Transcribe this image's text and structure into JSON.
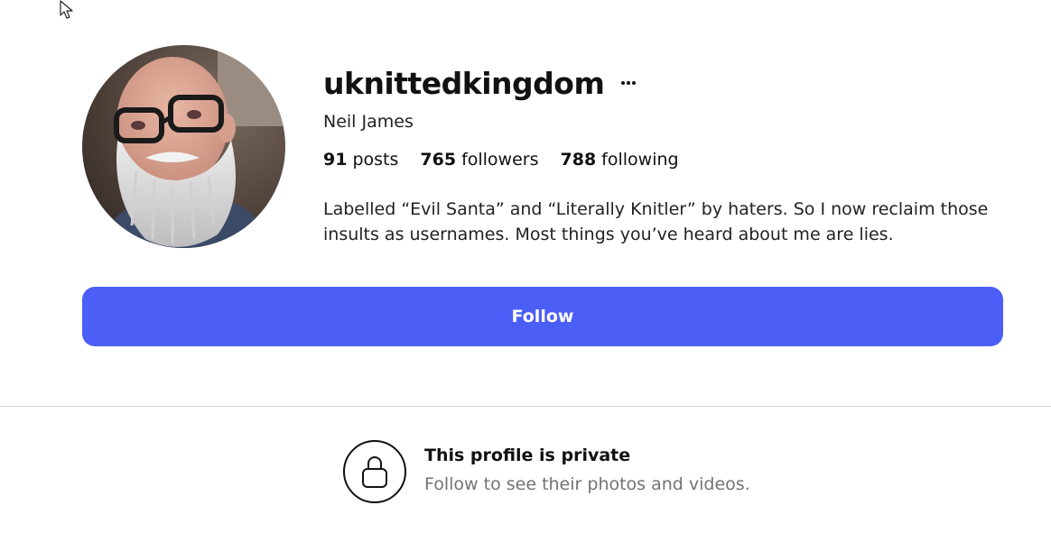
{
  "profile": {
    "username": "uknittedkingdom",
    "more_label": "···",
    "display_name": "Neil James",
    "stats": {
      "posts_count": "91",
      "posts_label": "posts",
      "followers_count": "765",
      "followers_label": "followers",
      "following_count": "788",
      "following_label": "following"
    },
    "bio": "Labelled “Evil Santa” and “Literally Knitler” by haters. So I now reclaim those insults as usernames. Most things you’ve heard about me are lies."
  },
  "actions": {
    "follow_label": "Follow"
  },
  "private_notice": {
    "title": "This profile is private",
    "subtitle": "Follow to see their photos and videos."
  },
  "icons": {
    "cursor": "mouse-pointer-icon",
    "more": "more-options-icon",
    "lock": "lock-icon"
  },
  "colors": {
    "accent": "#4b5ef6",
    "text_primary": "#111111",
    "text_secondary": "#737373",
    "divider": "#d6d6d6"
  }
}
